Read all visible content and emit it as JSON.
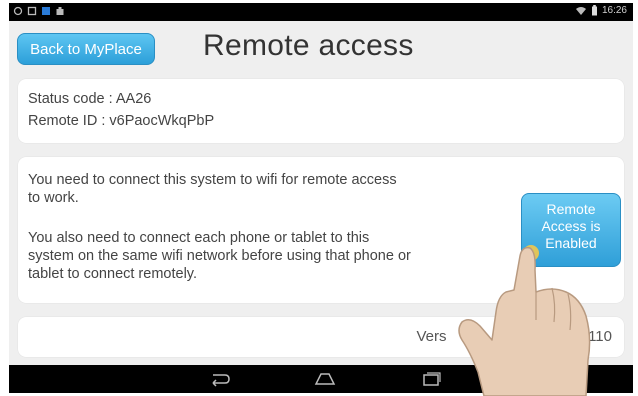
{
  "header": {
    "back_label": "Back to MyPlace",
    "title": "Remote access"
  },
  "status_bar": {
    "time": "16:26"
  },
  "info": {
    "status_code": "Status code : AA26",
    "remote_id": "Remote ID : v6PaocWkqPbP"
  },
  "notice": {
    "paragraph1_line1": "You need to connect this system to wifi for remote access",
    "paragraph1_line2": "to work.",
    "paragraph2_line1": "You also need to connect each phone or tablet to this",
    "paragraph2_line2": "system on the same wifi network before using that phone or",
    "paragraph2_line3": "tablet to connect remotely.",
    "button_line1": "Remote",
    "button_line2": "Access is",
    "button_line3": "Enabled"
  },
  "footer": {
    "version_visible_prefix": "Vers",
    "version_visible_suffix": "er : 11.110"
  },
  "colors": {
    "accent": "#2c9fd9",
    "background": "#efefef",
    "card": "#ffffff",
    "bars": "#000000"
  },
  "icons": [
    "back-nav-icon",
    "home-nav-icon",
    "recents-nav-icon",
    "wifi-icon",
    "battery-icon"
  ]
}
